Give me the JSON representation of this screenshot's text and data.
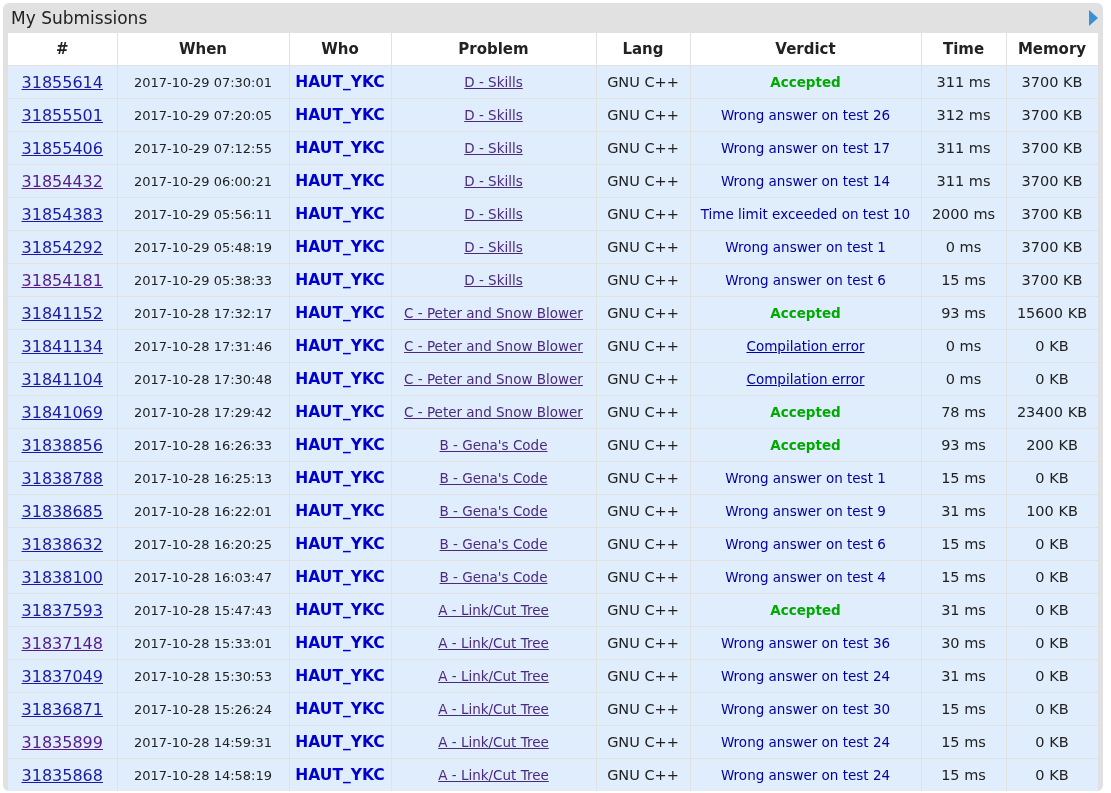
{
  "panel": {
    "title": "My Submissions"
  },
  "columns": [
    "#",
    "When",
    "Who",
    "Problem",
    "Lang",
    "Verdict",
    "Time",
    "Memory"
  ],
  "rows": [
    {
      "id": "31855614",
      "id_visited": false,
      "when": "2017-10-29 07:30:01",
      "who": "HAUT_YKC",
      "problem": "D - Skills",
      "lang": "GNU C++",
      "verdict": {
        "kind": "accepted",
        "text": "Accepted"
      },
      "time": "311 ms",
      "memory": "3700 KB"
    },
    {
      "id": "31855501",
      "id_visited": false,
      "when": "2017-10-29 07:20:05",
      "who": "HAUT_YKC",
      "problem": "D - Skills",
      "lang": "GNU C++",
      "verdict": {
        "kind": "rejected",
        "text": "Wrong answer on test 26"
      },
      "time": "312 ms",
      "memory": "3700 KB"
    },
    {
      "id": "31855406",
      "id_visited": false,
      "when": "2017-10-29 07:12:55",
      "who": "HAUT_YKC",
      "problem": "D - Skills",
      "lang": "GNU C++",
      "verdict": {
        "kind": "rejected",
        "text": "Wrong answer on test 17"
      },
      "time": "311 ms",
      "memory": "3700 KB"
    },
    {
      "id": "31854432",
      "id_visited": true,
      "when": "2017-10-29 06:00:21",
      "who": "HAUT_YKC",
      "problem": "D - Skills",
      "lang": "GNU C++",
      "verdict": {
        "kind": "rejected",
        "text": "Wrong answer on test 14"
      },
      "time": "311 ms",
      "memory": "3700 KB"
    },
    {
      "id": "31854383",
      "id_visited": false,
      "when": "2017-10-29 05:56:11",
      "who": "HAUT_YKC",
      "problem": "D - Skills",
      "lang": "GNU C++",
      "verdict": {
        "kind": "rejected",
        "text": "Time limit exceeded on test 10"
      },
      "time": "2000 ms",
      "memory": "3700 KB"
    },
    {
      "id": "31854292",
      "id_visited": false,
      "when": "2017-10-29 05:48:19",
      "who": "HAUT_YKC",
      "problem": "D - Skills",
      "lang": "GNU C++",
      "verdict": {
        "kind": "rejected",
        "text": "Wrong answer on test 1"
      },
      "time": "0 ms",
      "memory": "3700 KB"
    },
    {
      "id": "31854181",
      "id_visited": true,
      "when": "2017-10-29 05:38:33",
      "who": "HAUT_YKC",
      "problem": "D - Skills",
      "lang": "GNU C++",
      "verdict": {
        "kind": "rejected",
        "text": "Wrong answer on test 6"
      },
      "time": "15 ms",
      "memory": "3700 KB"
    },
    {
      "id": "31841152",
      "id_visited": false,
      "when": "2017-10-28 17:32:17",
      "who": "HAUT_YKC",
      "problem": "C - Peter and Snow Blower",
      "lang": "GNU C++",
      "verdict": {
        "kind": "accepted",
        "text": "Accepted"
      },
      "time": "93 ms",
      "memory": "15600 KB"
    },
    {
      "id": "31841134",
      "id_visited": false,
      "when": "2017-10-28 17:31:46",
      "who": "HAUT_YKC",
      "problem": "C - Peter and Snow Blower",
      "lang": "GNU C++",
      "verdict": {
        "kind": "compile",
        "text": "Compilation error"
      },
      "time": "0 ms",
      "memory": "0 KB"
    },
    {
      "id": "31841104",
      "id_visited": false,
      "when": "2017-10-28 17:30:48",
      "who": "HAUT_YKC",
      "problem": "C - Peter and Snow Blower",
      "lang": "GNU C++",
      "verdict": {
        "kind": "compile",
        "text": "Compilation error"
      },
      "time": "0 ms",
      "memory": "0 KB"
    },
    {
      "id": "31841069",
      "id_visited": false,
      "when": "2017-10-28 17:29:42",
      "who": "HAUT_YKC",
      "problem": "C - Peter and Snow Blower",
      "lang": "GNU C++",
      "verdict": {
        "kind": "accepted",
        "text": "Accepted"
      },
      "time": "78 ms",
      "memory": "23400 KB"
    },
    {
      "id": "31838856",
      "id_visited": false,
      "when": "2017-10-28 16:26:33",
      "who": "HAUT_YKC",
      "problem": "B - Gena's Code",
      "lang": "GNU C++",
      "verdict": {
        "kind": "accepted",
        "text": "Accepted"
      },
      "time": "93 ms",
      "memory": "200 KB"
    },
    {
      "id": "31838788",
      "id_visited": false,
      "when": "2017-10-28 16:25:13",
      "who": "HAUT_YKC",
      "problem": "B - Gena's Code",
      "lang": "GNU C++",
      "verdict": {
        "kind": "rejected",
        "text": "Wrong answer on test 1"
      },
      "time": "15 ms",
      "memory": "0 KB"
    },
    {
      "id": "31838685",
      "id_visited": false,
      "when": "2017-10-28 16:22:01",
      "who": "HAUT_YKC",
      "problem": "B - Gena's Code",
      "lang": "GNU C++",
      "verdict": {
        "kind": "rejected",
        "text": "Wrong answer on test 9"
      },
      "time": "31 ms",
      "memory": "100 KB"
    },
    {
      "id": "31838632",
      "id_visited": false,
      "when": "2017-10-28 16:20:25",
      "who": "HAUT_YKC",
      "problem": "B - Gena's Code",
      "lang": "GNU C++",
      "verdict": {
        "kind": "rejected",
        "text": "Wrong answer on test 6"
      },
      "time": "15 ms",
      "memory": "0 KB"
    },
    {
      "id": "31838100",
      "id_visited": false,
      "when": "2017-10-28 16:03:47",
      "who": "HAUT_YKC",
      "problem": "B - Gena's Code",
      "lang": "GNU C++",
      "verdict": {
        "kind": "rejected",
        "text": "Wrong answer on test 4"
      },
      "time": "15 ms",
      "memory": "0 KB"
    },
    {
      "id": "31837593",
      "id_visited": false,
      "when": "2017-10-28 15:47:43",
      "who": "HAUT_YKC",
      "problem": "A - Link/Cut Tree",
      "lang": "GNU C++",
      "verdict": {
        "kind": "accepted",
        "text": "Accepted"
      },
      "time": "31 ms",
      "memory": "0 KB"
    },
    {
      "id": "31837148",
      "id_visited": true,
      "when": "2017-10-28 15:33:01",
      "who": "HAUT_YKC",
      "problem": "A - Link/Cut Tree",
      "lang": "GNU C++",
      "verdict": {
        "kind": "rejected",
        "text": "Wrong answer on test 36"
      },
      "time": "30 ms",
      "memory": "0 KB"
    },
    {
      "id": "31837049",
      "id_visited": false,
      "when": "2017-10-28 15:30:53",
      "who": "HAUT_YKC",
      "problem": "A - Link/Cut Tree",
      "lang": "GNU C++",
      "verdict": {
        "kind": "rejected",
        "text": "Wrong answer on test 24"
      },
      "time": "31 ms",
      "memory": "0 KB"
    },
    {
      "id": "31836871",
      "id_visited": false,
      "when": "2017-10-28 15:26:24",
      "who": "HAUT_YKC",
      "problem": "A - Link/Cut Tree",
      "lang": "GNU C++",
      "verdict": {
        "kind": "rejected",
        "text": "Wrong answer on test 30"
      },
      "time": "15 ms",
      "memory": "0 KB"
    },
    {
      "id": "31835899",
      "id_visited": true,
      "when": "2017-10-28 14:59:31",
      "who": "HAUT_YKC",
      "problem": "A - Link/Cut Tree",
      "lang": "GNU C++",
      "verdict": {
        "kind": "rejected",
        "text": "Wrong answer on test 24"
      },
      "time": "15 ms",
      "memory": "0 KB"
    },
    {
      "id": "31835868",
      "id_visited": false,
      "when": "2017-10-28 14:58:19",
      "who": "HAUT_YKC",
      "problem": "A - Link/Cut Tree",
      "lang": "GNU C++",
      "verdict": {
        "kind": "rejected",
        "text": "Wrong answer on test 24"
      },
      "time": "15 ms",
      "memory": "0 KB"
    }
  ]
}
